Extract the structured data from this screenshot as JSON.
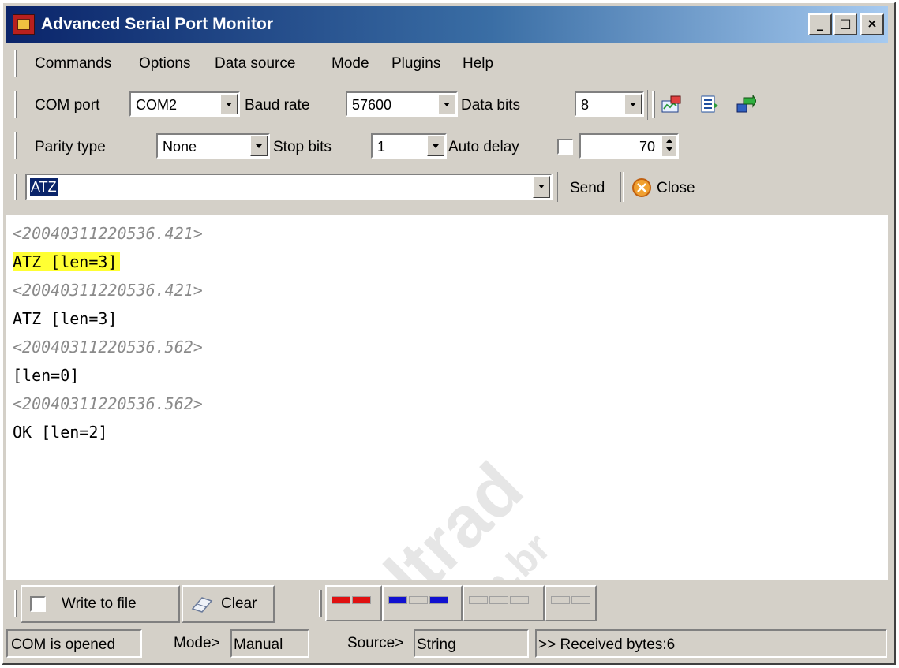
{
  "window": {
    "title": "Advanced Serial Port Monitor",
    "minimize_glyph": "_",
    "maximize_glyph": "□",
    "close_glyph": "×"
  },
  "menu": {
    "items": [
      "Commands",
      "Options",
      "Data source",
      "Mode",
      "Plugins",
      "Help"
    ]
  },
  "port_settings": {
    "com_port_label": "COM port",
    "com_port_value": "COM2",
    "baud_rate_label": "Baud rate",
    "baud_rate_value": "57600",
    "data_bits_label": "Data bits",
    "data_bits_value": "8",
    "toolbar_icons": [
      "monitor-chart-icon",
      "document-list-icon",
      "export-arrow-icon"
    ]
  },
  "port_settings_2": {
    "parity_label": "Parity type",
    "parity_value": "None",
    "stop_bits_label": "Stop bits",
    "stop_bits_value": "1",
    "auto_delay_label": "Auto delay",
    "auto_delay_checked": false,
    "auto_delay_value": "70"
  },
  "command_bar": {
    "command_value": "ATZ",
    "send_label": "Send",
    "close_label": "Close"
  },
  "log": {
    "lines": [
      {
        "text": "<20040311220536.421>",
        "kind": "timestamp"
      },
      {
        "text": "ATZ [len=3]",
        "kind": "sent-highlighted"
      },
      {
        "text": "<20040311220536.421>",
        "kind": "timestamp"
      },
      {
        "text": "ATZ [len=3]",
        "kind": "data"
      },
      {
        "text": "<20040311220536.562>",
        "kind": "timestamp"
      },
      {
        "text": "[len=0]",
        "kind": "data"
      },
      {
        "text": "<20040311220536.562>",
        "kind": "timestamp"
      },
      {
        "text": "OK [len=2]",
        "kind": "data"
      }
    ],
    "highlight_color": "#ffff33",
    "timestamp_color": "#8a8a8a"
  },
  "watermark": {
    "line1": "ultrad",
    "line2": ".com.br"
  },
  "bottom_toolbar": {
    "write_to_file_label": "Write to file",
    "write_to_file_checked": false,
    "clear_label": "Clear",
    "indicators": [
      {
        "colors": [
          "#e01010",
          "#e01010"
        ]
      },
      {
        "colors": [
          "#1010d0",
          "#d4d0c8",
          "#1010d0"
        ]
      },
      {
        "colors": [
          "#d4d0c8",
          "#d4d0c8",
          "#d4d0c8"
        ]
      },
      {
        "colors": [
          "#d4d0c8",
          "#d4d0c8"
        ]
      }
    ]
  },
  "status": {
    "connection": "COM is opened",
    "mode_label": "Mode>",
    "mode_value": "Manual",
    "source_label": "Source>",
    "source_value": "String",
    "received": ">> Received bytes:6"
  }
}
